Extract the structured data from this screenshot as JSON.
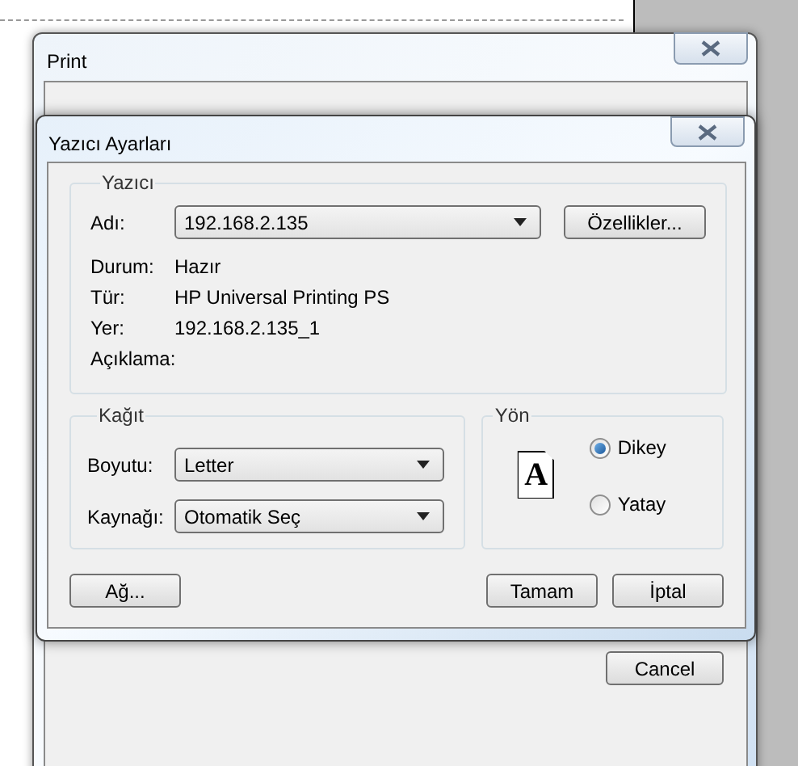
{
  "print_window": {
    "title": "Print",
    "cancel_button": "Cancel"
  },
  "dialog": {
    "title": "Yazıcı Ayarları",
    "printer_group": {
      "legend": "Yazıcı",
      "name_label": "Adı:",
      "name_value": "192.168.2.135",
      "properties_button": "Özellikler...",
      "info": [
        {
          "label": "Durum:",
          "value": "Hazır"
        },
        {
          "label": "Tür:",
          "value": "HP Universal Printing PS"
        },
        {
          "label": "Yer:",
          "value": "192.168.2.135_1"
        },
        {
          "label": "Açıklama:"
        }
      ]
    },
    "paper_group": {
      "legend": "Kağıt",
      "fields": [
        {
          "label": "Boyutu:",
          "value": "Letter"
        },
        {
          "label": "Kaynağı:",
          "value": "Otomatik Seç"
        }
      ]
    },
    "orientation_group": {
      "legend": "Yön",
      "icon_letter": "A",
      "options": [
        {
          "label": "Dikey",
          "selected": true
        },
        {
          "label": "Yatay",
          "selected": false
        }
      ]
    },
    "network_button": "Ağ...",
    "ok_button": "Tamam",
    "cancel_button": "İptal"
  }
}
